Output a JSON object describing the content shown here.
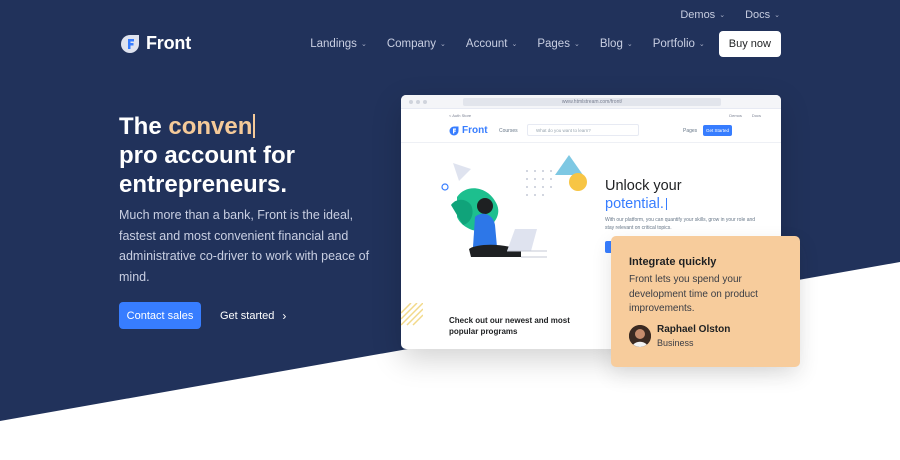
{
  "topbar": {
    "links": [
      {
        "label": "Demos"
      },
      {
        "label": "Docs"
      }
    ]
  },
  "brand": {
    "name": "Front"
  },
  "nav": {
    "items": [
      "Landings",
      "Company",
      "Account",
      "Pages",
      "Blog",
      "Portfolio"
    ],
    "cta": "Buy now"
  },
  "hero": {
    "headline_prefix": "The ",
    "headline_typed": "conven",
    "headline_line2": "pro account for",
    "headline_line3": "entrepreneurs.",
    "lead": "Much more than a bank, Front is the ideal, fastest and most convenient financial and administrative co-driver to work with peace of mind.",
    "primary_cta": "Contact sales",
    "secondary_cta": "Get started"
  },
  "mockup": {
    "url": "www.htmlstream.com/front/",
    "back_link": "< Auth Store",
    "top_right": [
      "Demos",
      "Docs"
    ],
    "brand": "Front",
    "courses": "Courses",
    "search_placeholder": "What do you want to learn?",
    "pages": "Pages",
    "get_started": "Get Started",
    "title_line1": "Unlock your",
    "title_line2": "potential.",
    "description": "With our platform, you can quantify your skills, grow in your role and stay relevant on critical topics.",
    "promo": "Check out our newest and most popular programs"
  },
  "card": {
    "title": "Integrate quickly",
    "body": "Front lets you spend your development time on product improvements.",
    "author": "Raphael Olston",
    "role": "Business"
  },
  "colors": {
    "navy": "#21325b",
    "primary": "#377dff",
    "peach": "#f7cc9c",
    "accent": "#f5ca99"
  },
  "icons": [
    "front-logo-icon",
    "chevron-down-icon",
    "chevron-right-icon"
  ]
}
